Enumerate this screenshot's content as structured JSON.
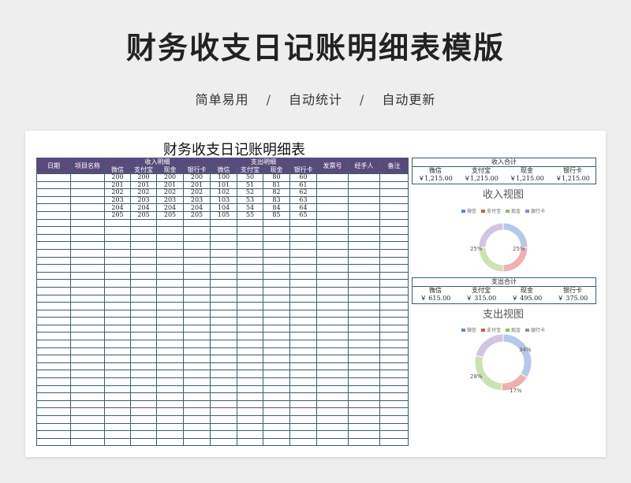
{
  "banner": {
    "title": "财务收支日记账明细表模版",
    "subtitle_parts": [
      "简单易用",
      "自动统计",
      "自动更新"
    ],
    "separator": "/"
  },
  "sheet": {
    "title": "财务收支日记账明细表",
    "headers": {
      "date": "日期",
      "item": "项目名称",
      "income_group": "收入明细",
      "expense_group": "支出明细",
      "invoice": "发票号",
      "handler": "经手人",
      "note": "备注"
    },
    "channels": [
      "微信",
      "支付宝",
      "现金",
      "银行卡"
    ],
    "rows": [
      {
        "income": [
          "200",
          "200",
          "200",
          "200"
        ],
        "expense": [
          "100",
          "50",
          "80",
          "60"
        ]
      },
      {
        "income": [
          "201",
          "201",
          "201",
          "201"
        ],
        "expense": [
          "101",
          "51",
          "81",
          "61"
        ]
      },
      {
        "income": [
          "202",
          "202",
          "202",
          "202"
        ],
        "expense": [
          "102",
          "52",
          "82",
          "62"
        ]
      },
      {
        "income": [
          "203",
          "203",
          "203",
          "203"
        ],
        "expense": [
          "103",
          "53",
          "83",
          "63"
        ]
      },
      {
        "income": [
          "204",
          "204",
          "204",
          "204"
        ],
        "expense": [
          "104",
          "54",
          "84",
          "64"
        ]
      },
      {
        "income": [
          "205",
          "205",
          "205",
          "205"
        ],
        "expense": [
          "105",
          "55",
          "85",
          "65"
        ]
      }
    ],
    "blank_rows": 30
  },
  "income_summary": {
    "title": "收入合计",
    "labels": [
      "微信",
      "支付宝",
      "现金",
      "银行卡"
    ],
    "values": [
      "￥1,215.00",
      "￥1,215.00",
      "￥1,215.00",
      "￥1,215.00"
    ]
  },
  "expense_summary": {
    "title": "支出合计",
    "labels": [
      "微信",
      "支付宝",
      "现金",
      "银行卡"
    ],
    "values": [
      "￥   615.00",
      "￥   315.00",
      "￥   495.00",
      "￥   375.00"
    ]
  },
  "income_chart": {
    "title": "收入视图",
    "legend": [
      "微信",
      "支付宝",
      "现金",
      "银行卡"
    ],
    "shares": [
      25,
      25,
      25,
      25
    ],
    "labels": [
      "25%",
      "25%"
    ],
    "colors": [
      "#5b87c9",
      "#d9534f",
      "#8fbf5a",
      "#9b7fc4"
    ]
  },
  "expense_chart": {
    "title": "支出视图",
    "legend": [
      "微信",
      "支付宝",
      "现金",
      "银行卡"
    ],
    "shares": [
      34,
      17,
      28,
      21
    ],
    "labels": [
      "34%",
      "17%",
      "28%"
    ],
    "colors": [
      "#5b87c9",
      "#d9534f",
      "#8fbf5a",
      "#9b7fc4"
    ]
  }
}
